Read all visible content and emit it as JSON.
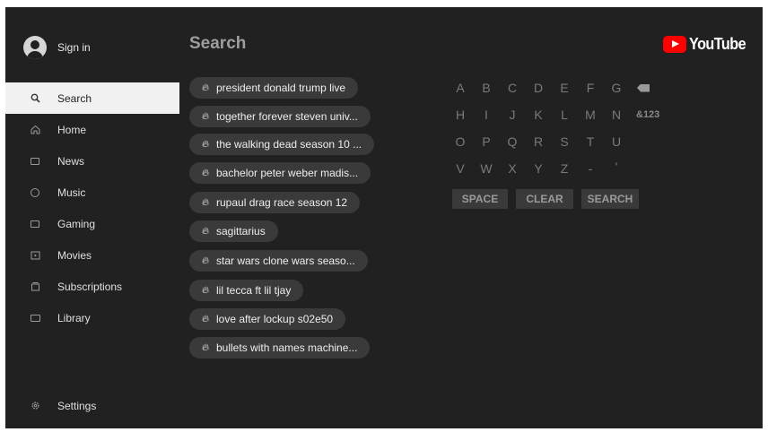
{
  "header": {
    "title": "Search",
    "logo_text": "YouTube"
  },
  "sidebar": {
    "sign_in": "Sign in",
    "items": [
      {
        "label": "Search",
        "icon": "search-icon"
      },
      {
        "label": "Home",
        "icon": "home-icon"
      },
      {
        "label": "News",
        "icon": "news-icon"
      },
      {
        "label": "Music",
        "icon": "music-icon"
      },
      {
        "label": "Gaming",
        "icon": "gaming-icon"
      },
      {
        "label": "Movies",
        "icon": "movies-icon"
      },
      {
        "label": "Subscriptions",
        "icon": "subscriptions-icon"
      },
      {
        "label": "Library",
        "icon": "library-icon"
      }
    ],
    "settings": "Settings"
  },
  "suggestions": [
    "president donald trump live",
    "together forever steven univ...",
    "the walking dead season 10 ...",
    "bachelor peter weber madis...",
    "rupaul drag race season 12",
    "sagittarius",
    "star wars clone wars seaso...",
    "lil tecca ft lil tjay",
    "love after lockup s02e50",
    "bullets with names machine..."
  ],
  "keyboard": {
    "rows": [
      [
        "A",
        "B",
        "C",
        "D",
        "E",
        "F",
        "G"
      ],
      [
        "H",
        "I",
        "J",
        "K",
        "L",
        "M",
        "N"
      ],
      [
        "O",
        "P",
        "Q",
        "R",
        "S",
        "T",
        "U"
      ],
      [
        "V",
        "W",
        "X",
        "Y",
        "Z",
        "-",
        "'"
      ]
    ],
    "symbols_key": "&123",
    "space": "SPACE",
    "clear": "CLEAR",
    "search": "SEARCH"
  },
  "colors": {
    "background": "#212121",
    "chip": "#3a3a3a",
    "brand_red": "#ff0000",
    "active_nav": "#f1f1f1"
  }
}
